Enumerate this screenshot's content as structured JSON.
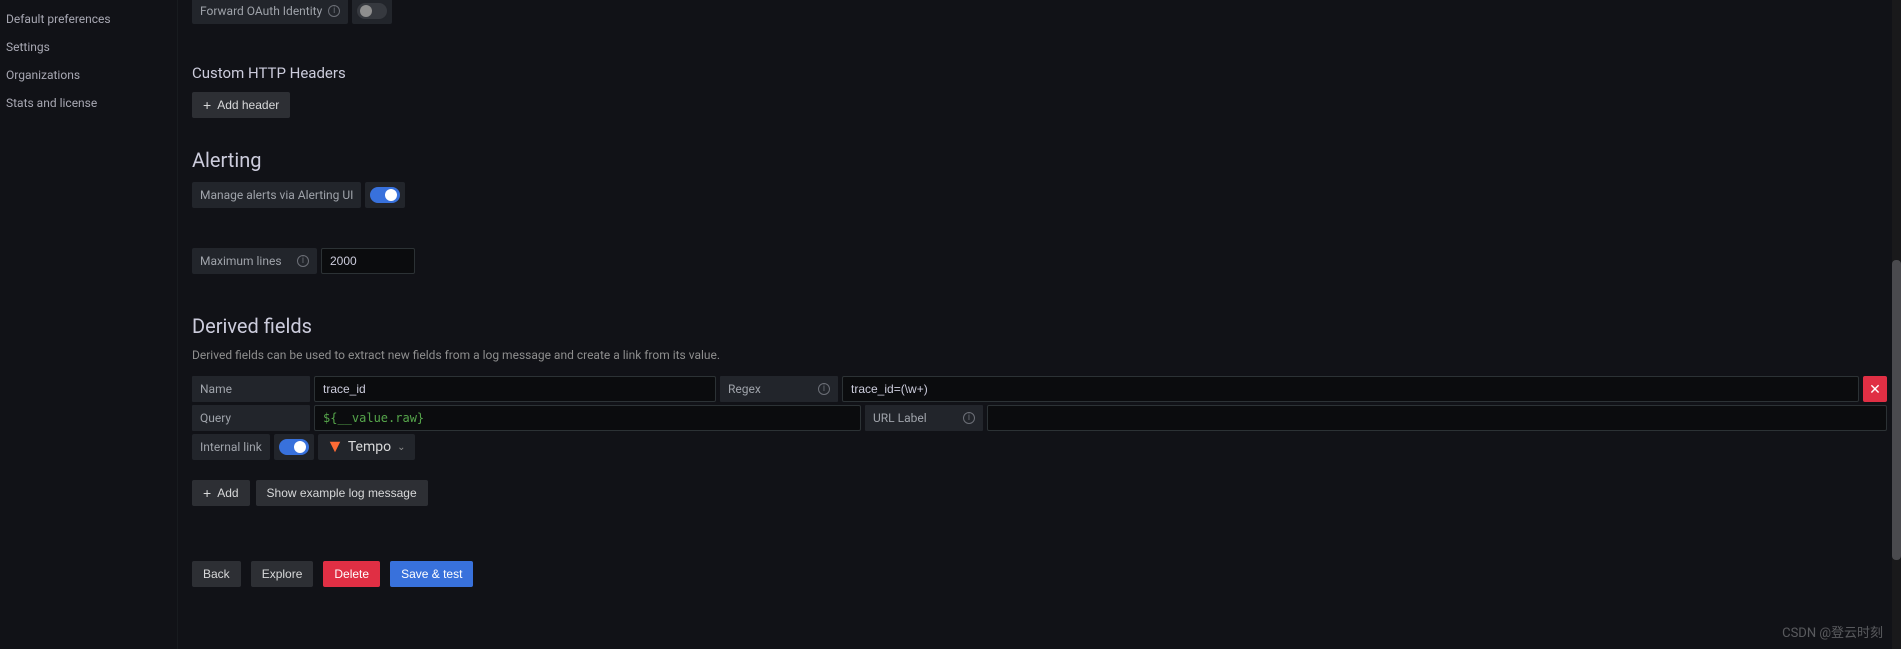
{
  "sidebar": {
    "items": [
      {
        "label": "Default preferences"
      },
      {
        "label": "Settings"
      },
      {
        "label": "Organizations"
      },
      {
        "label": "Stats and license"
      }
    ]
  },
  "auth": {
    "forward_oauth_label": "Forward OAuth Identity"
  },
  "custom_headers": {
    "title": "Custom HTTP Headers",
    "add_btn_label": "Add header"
  },
  "alerting": {
    "title": "Alerting",
    "manage_label": "Manage alerts via Alerting UI"
  },
  "max_lines": {
    "label": "Maximum lines",
    "value": "2000"
  },
  "derived_fields": {
    "title": "Derived fields",
    "description": "Derived fields can be used to extract new fields from a log message and create a link from its value.",
    "labels": {
      "name": "Name",
      "regex": "Regex",
      "query": "Query",
      "url_label": "URL Label",
      "internal_link": "Internal link"
    },
    "field": {
      "name": "trace_id",
      "regex": "trace_id=(\\w+)",
      "query": "${__value.raw}",
      "url_label": ""
    },
    "datasource_name": "Tempo",
    "add_btn": "Add",
    "example_btn": "Show example log message"
  },
  "actions": {
    "back": "Back",
    "explore": "Explore",
    "delete": "Delete",
    "save_test": "Save & test"
  },
  "watermark": "CSDN @登云时刻"
}
